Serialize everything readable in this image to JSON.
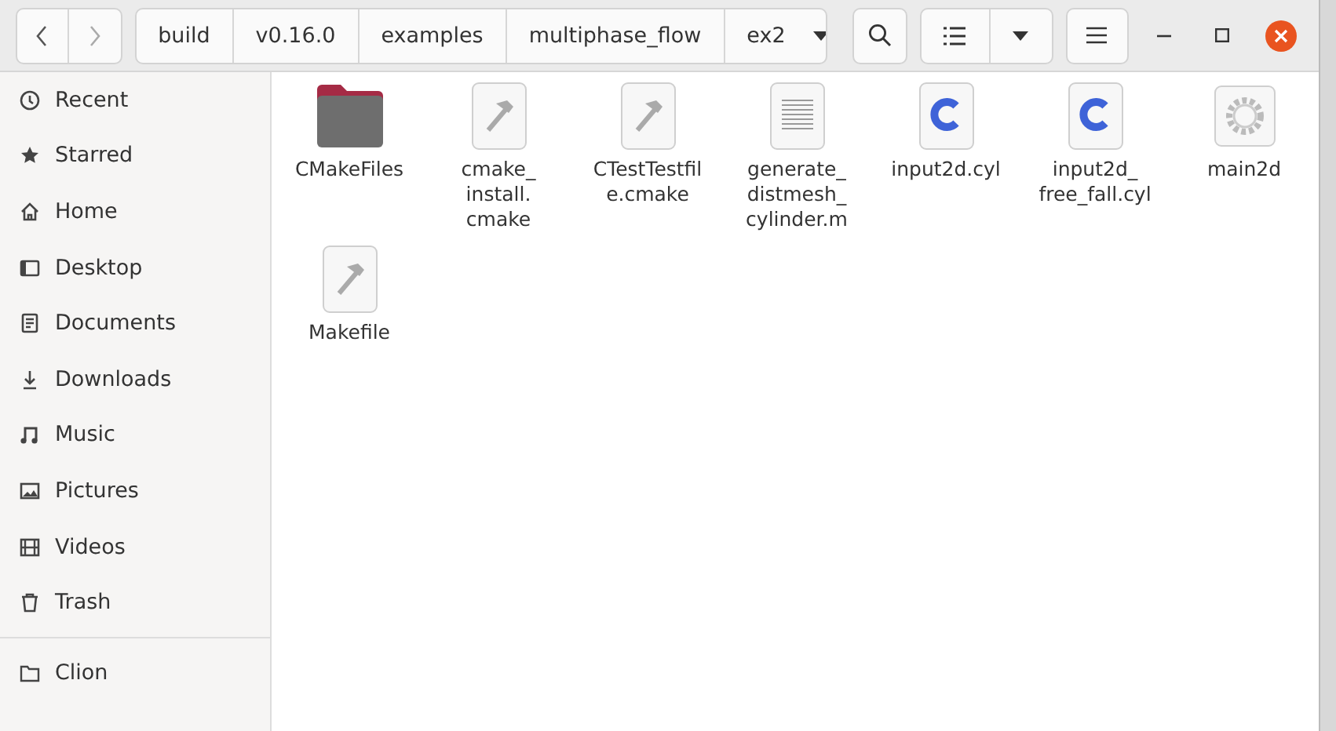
{
  "path_bar": [
    {
      "label": "build"
    },
    {
      "label": "v0.16.0"
    },
    {
      "label": "examples"
    },
    {
      "label": "multiphase_flow"
    },
    {
      "label": "ex2"
    }
  ],
  "sidebar": {
    "items": [
      {
        "label": "Recent",
        "kind": "recent"
      },
      {
        "label": "Starred",
        "kind": "starred"
      },
      {
        "label": "Home",
        "kind": "home"
      },
      {
        "label": "Desktop",
        "kind": "desktop"
      },
      {
        "label": "Documents",
        "kind": "documents"
      },
      {
        "label": "Downloads",
        "kind": "downloads"
      },
      {
        "label": "Music",
        "kind": "music"
      },
      {
        "label": "Pictures",
        "kind": "pictures"
      },
      {
        "label": "Videos",
        "kind": "videos"
      },
      {
        "label": "Trash",
        "kind": "trash"
      }
    ],
    "bookmarks": [
      {
        "label": "Clion",
        "kind": "folder"
      }
    ]
  },
  "files": [
    {
      "name": "CMakeFiles",
      "kind": "folder"
    },
    {
      "name": "cmake_\ninstall.\ncmake",
      "kind": "script"
    },
    {
      "name": "CTestTestfil\ne.cmake",
      "kind": "script"
    },
    {
      "name": "generate_\ndistmesh_\ncylinder.m",
      "kind": "text"
    },
    {
      "name": "input2d.cyl",
      "kind": "c-source"
    },
    {
      "name": "input2d_\nfree_fall.cyl",
      "kind": "c-source"
    },
    {
      "name": "main2d",
      "kind": "executable"
    },
    {
      "name": "Makefile",
      "kind": "script"
    }
  ]
}
